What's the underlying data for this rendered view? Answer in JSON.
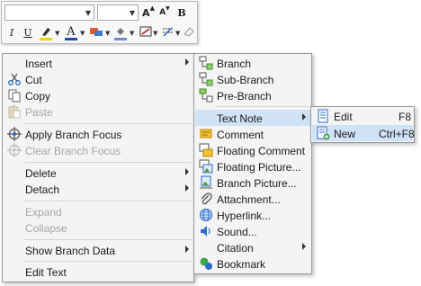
{
  "toolbar": {
    "font_family_value": "",
    "font_size_value": "",
    "grow_font": "A",
    "shrink_font": "A",
    "bold": "B",
    "italic": "I",
    "underline": "U",
    "highlight_color": "#f2d400",
    "font_color": "#1f4ea8",
    "fill_color": "#e05a2b",
    "line_color": "#c23b3b"
  },
  "context_menu": {
    "insert": "Insert",
    "cut": "Cut",
    "copy": "Copy",
    "paste": "Paste",
    "apply_branch_focus": "Apply Branch Focus",
    "clear_branch_focus": "Clear Branch Focus",
    "delete": "Delete",
    "detach": "Detach",
    "expand": "Expand",
    "collapse": "Collapse",
    "show_branch_data": "Show Branch Data",
    "edit_text": "Edit Text"
  },
  "insert_menu": {
    "branch": "Branch",
    "sub_branch": "Sub-Branch",
    "pre_branch": "Pre-Branch",
    "text_note": "Text Note",
    "comment": "Comment",
    "floating_comment": "Floating Comment",
    "floating_picture": "Floating Picture...",
    "branch_picture": "Branch Picture...",
    "attachment": "Attachment...",
    "hyperlink": "Hyperlink...",
    "sound": "Sound...",
    "citation": "Citation",
    "bookmark": "Bookmark"
  },
  "text_note_menu": {
    "edit": "Edit",
    "edit_shortcut": "F8",
    "new": "New",
    "new_shortcut": "Ctrl+F8"
  },
  "colors": {
    "highlight_bg": "#cfe2f6",
    "menu_bg": "#f4f4f4",
    "accent_blue": "#2b6cc4"
  }
}
